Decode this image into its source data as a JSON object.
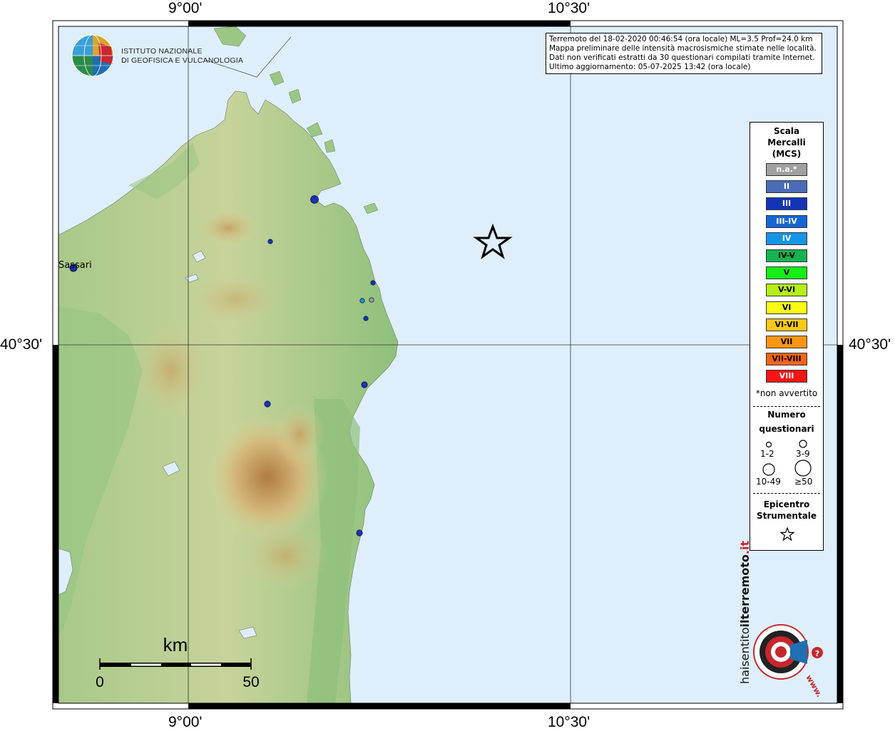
{
  "map": {
    "coordinates": {
      "lon_left": "9°00'",
      "lon_right": "10°30'",
      "lat_center": "40°30'"
    },
    "place_labels": [
      {
        "name": "Sassari"
      }
    ],
    "epicenter_symbol": "star-icon",
    "scale_bar": {
      "unit": "km",
      "start": "0",
      "end": "50"
    },
    "colors": {
      "sea": "#deeffb",
      "land_low": "#8fbf7a",
      "land_mid": "#d6cc92",
      "land_high": "#b58a52",
      "intensity_II": "#4a6cb8",
      "intensity_III": "#1433b8",
      "intensity_IV": "#1495e6",
      "intensity_na": "#a0a0a0"
    },
    "observations": [
      {
        "intensity": "III",
        "count_class": "10-49"
      },
      {
        "intensity": "III",
        "count_class": "3-9"
      },
      {
        "intensity": "III",
        "count_class": "3-9"
      },
      {
        "intensity": "IV",
        "count_class": "1-2"
      },
      {
        "intensity": "n.a.*",
        "count_class": "1-2"
      },
      {
        "intensity": "III",
        "count_class": "1-2"
      },
      {
        "intensity": "III",
        "count_class": "1-2"
      },
      {
        "intensity": "III",
        "count_class": "1-2"
      },
      {
        "intensity": "III",
        "count_class": "3-9"
      },
      {
        "intensity": "III",
        "count_class": "3-9"
      }
    ]
  },
  "logo": {
    "line1": "ISTITUTO NAZIONALE",
    "line2": "DI GEOFISICA E VULCANOLOGIA"
  },
  "info": {
    "line1": "Terremoto del 18-02-2020 00:46:54 (ora locale) ML=3.5 Prof=24.0 km",
    "line2": "Mappa preliminare delle intensità macrosismiche stimate nelle località.",
    "line3": "Dati non verificati estratti da 30 questionari compilati tramite Internet.",
    "line4": "Ultimo aggiornamento: 05-07-2025 13:42 (ora locale)"
  },
  "legend": {
    "title_line1": "Scala",
    "title_line2": "Mercalli",
    "title_line3": "(MCS)",
    "intensities": [
      {
        "label": "n.a.*",
        "color": "#a0a0a0",
        "text_color": "#ffffff"
      },
      {
        "label": "II",
        "color": "#4a6cb8",
        "text_color": "#ffffff"
      },
      {
        "label": "III",
        "color": "#1433b8",
        "text_color": "#ffffff"
      },
      {
        "label": "III-IV",
        "color": "#1466d6",
        "text_color": "#ffffff"
      },
      {
        "label": "IV",
        "color": "#1495e6",
        "text_color": "#ffffff"
      },
      {
        "label": "IV-V",
        "color": "#14b450",
        "text_color": "#000000"
      },
      {
        "label": "V",
        "color": "#14f014",
        "text_color": "#000000"
      },
      {
        "label": "V-VI",
        "color": "#b4f014",
        "text_color": "#000000"
      },
      {
        "label": "VI",
        "color": "#fafa14",
        "text_color": "#000000"
      },
      {
        "label": "VI-VII",
        "color": "#fac814",
        "text_color": "#000000"
      },
      {
        "label": "VII",
        "color": "#fa9614",
        "text_color": "#000000"
      },
      {
        "label": "VII-VIII",
        "color": "#fa6414",
        "text_color": "#000000"
      },
      {
        "label": "VIII",
        "color": "#fa1414",
        "text_color": "#ffffff"
      }
    ],
    "note": "*non avvertito",
    "count_title1": "Numero",
    "count_title2": "questionari",
    "counts": [
      "1-2",
      "3-9",
      "10-49",
      "≥50"
    ],
    "epicenter_title1": "Epicentro",
    "epicenter_title2": "Strumentale"
  },
  "badge": {
    "text_left": "haisentito",
    "text_mid": "ilterremoto",
    "text_tld": ".it",
    "text_www": "www."
  }
}
